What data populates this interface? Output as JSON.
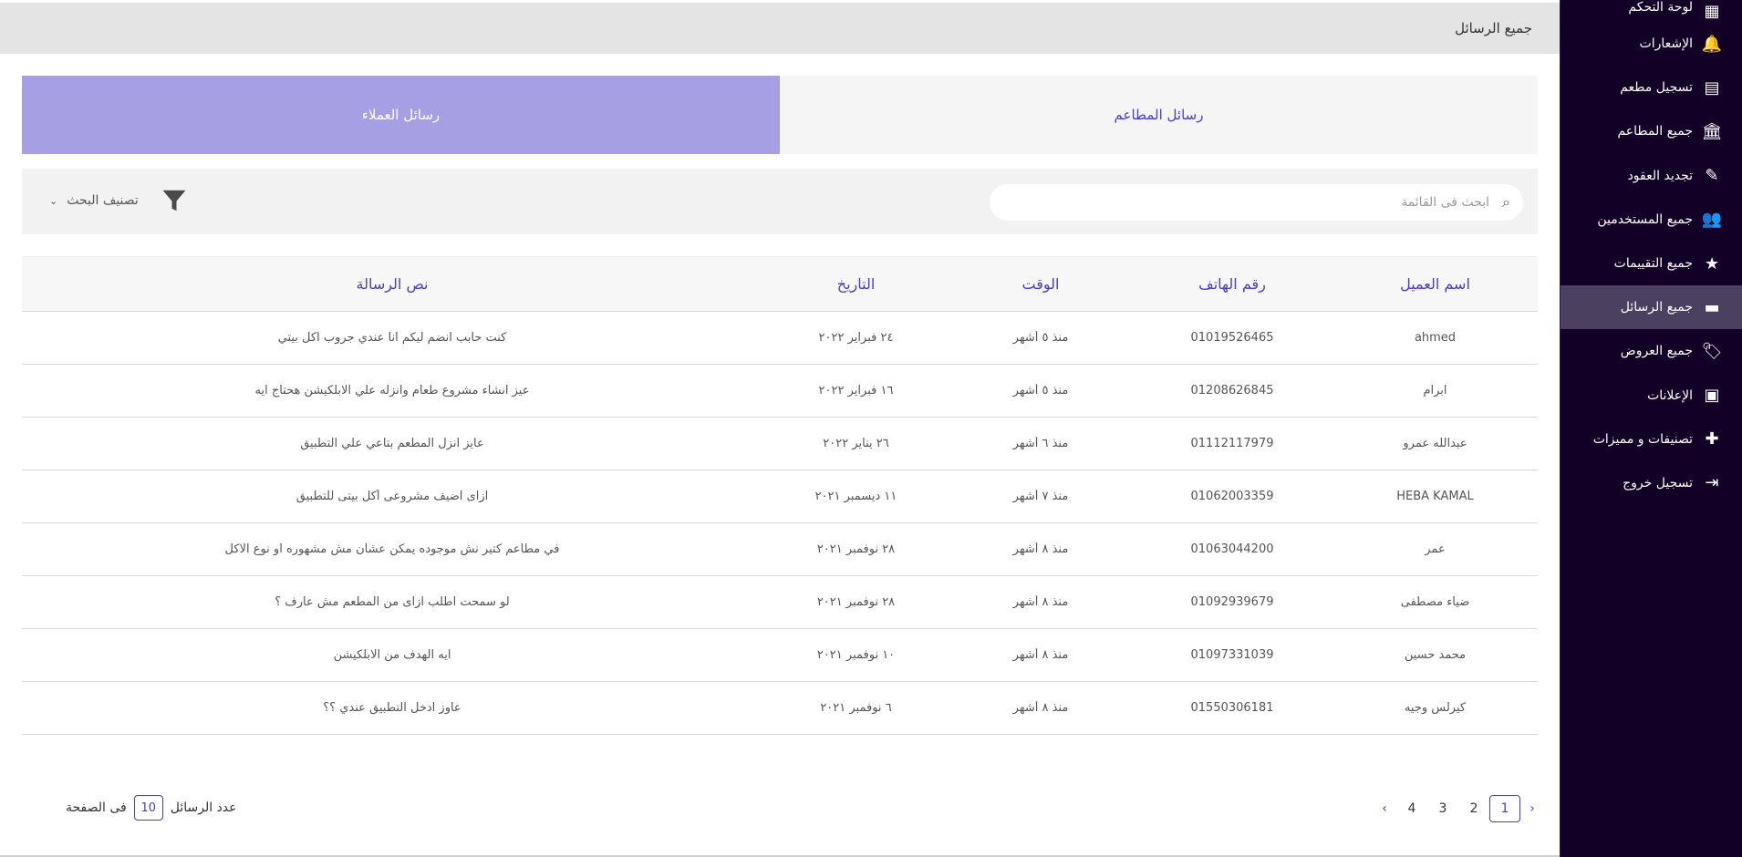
{
  "header": {
    "title": "جميع الرسائل"
  },
  "sidebar": {
    "items": [
      {
        "label": "لوحة التحكم",
        "icon": "dashboard-icon",
        "glyph": "▦"
      },
      {
        "label": "الإشعارات",
        "icon": "bell-icon",
        "glyph": "🔔"
      },
      {
        "label": "تسجيل مطعم",
        "icon": "register-restaurant-icon",
        "glyph": "▤"
      },
      {
        "label": "جميع المطاعم",
        "icon": "bank-icon",
        "glyph": "🏛"
      },
      {
        "label": "تجديد العقود",
        "icon": "contract-icon",
        "glyph": "✎"
      },
      {
        "label": "جميع المستخدمين",
        "icon": "users-icon",
        "glyph": "👥"
      },
      {
        "label": "جميع التقييمات",
        "icon": "star-icon",
        "glyph": "★"
      },
      {
        "label": "جميع الرسائل",
        "icon": "message-icon",
        "glyph": "▬",
        "active": true
      },
      {
        "label": "جميع العروض",
        "icon": "tag-icon",
        "glyph": "🏷"
      },
      {
        "label": "الإعلانات",
        "icon": "ad-icon",
        "glyph": "▣"
      },
      {
        "label": "تصنيفات و مميزات",
        "icon": "plus-icon",
        "glyph": "✚"
      },
      {
        "label": "تسجيل خروج",
        "icon": "logout-icon",
        "glyph": "⇥"
      }
    ]
  },
  "tabs": {
    "restaurants": "رسائل المطاعم",
    "customers": "رسائل العملاء"
  },
  "search": {
    "placeholder": "ابحث فى القائمة"
  },
  "filter": {
    "label": "تصنيف البحث"
  },
  "table": {
    "headers": {
      "name": "اسم العميل",
      "phone": "رقم الهاتف",
      "time": "الوقت",
      "date": "التاريخ",
      "message": "نص الرسالة"
    },
    "rows": [
      {
        "name": "ahmed",
        "phone": "01019526465",
        "time": "منذ ٥ أشهر",
        "date": "٢٤ فبراير ٢٠٢٢",
        "message": "كنت حابب انضم ليكم انا عندي جروب اكل بيتي"
      },
      {
        "name": "ابرام",
        "phone": "01208626845",
        "time": "منذ ٥ أشهر",
        "date": "١٦ فبراير ٢٠٢٢",
        "message": "عيز انشاء مشروع طعام وانزله علي الابلكيشن هحتاج ايه"
      },
      {
        "name": "عبدالله عمرو",
        "phone": "01112117979",
        "time": "منذ ٦ أشهر",
        "date": "٢٦ يناير ٢٠٢٢",
        "message": "عايز انزل المطعم بتاعي علي التطبيق"
      },
      {
        "name": "HEBA KAMAL",
        "phone": "01062003359",
        "time": "منذ ٧ أشهر",
        "date": "١١ ديسمبر ٢٠٢١",
        "message": "ازاى اضيف مشروعى أكل بيتى للتطبيق"
      },
      {
        "name": "عمر",
        "phone": "01063044200",
        "time": "منذ ٨ أشهر",
        "date": "٢٨ نوفمبر ٢٠٢١",
        "message": "في مطاعم كتير نش موجوده يمكن عشان مش مشهوره او نوع الاكل"
      },
      {
        "name": "ضياء مصطفى",
        "phone": "01092939679",
        "time": "منذ ٨ أشهر",
        "date": "٢٨ نوفمبر ٢٠٢١",
        "message": "لو سمحت اطلب ازاى من المطعم مش عارف ؟"
      },
      {
        "name": "محمد حسين",
        "phone": "01097331039",
        "time": "منذ ٨ أشهر",
        "date": "١٠ نوفمبر ٢٠٢١",
        "message": "ايه الهدف من الابلكيشن"
      },
      {
        "name": "كيرلس وجيه",
        "phone": "01550306181",
        "time": "منذ ٨ أشهر",
        "date": "٦ نوفمبر ٢٠٢١",
        "message": "عاوز ادخل التطبيق عندي ؟؟"
      }
    ]
  },
  "pagination": {
    "prev": "‹",
    "next": "›",
    "pages": [
      "1",
      "2",
      "3",
      "4"
    ],
    "current": "1"
  },
  "per_page": {
    "label": "عدد الرسائل",
    "value": "10",
    "suffix": "فى الصفحة"
  },
  "colors": {
    "accent": "#4a3ccf",
    "active_tab": "#a69fe4",
    "sidebar": "#130027"
  }
}
